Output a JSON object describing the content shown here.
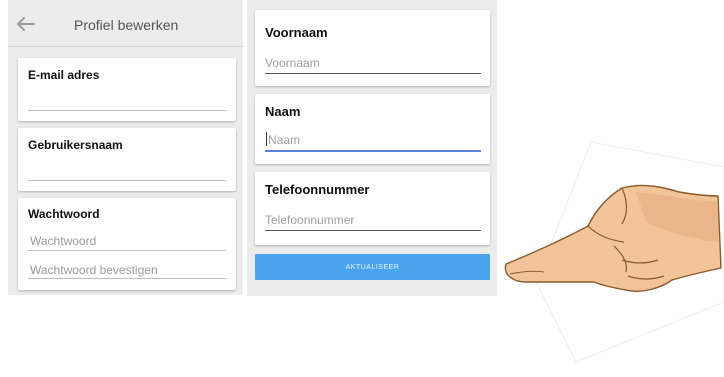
{
  "header": {
    "title": "Profiel bewerken",
    "back_icon": "arrow-left-icon"
  },
  "left_form": {
    "email": {
      "label": "E-mail adres",
      "value": ""
    },
    "username": {
      "label": "Gebruikersnaam",
      "value": ""
    },
    "password": {
      "label": "Wachtwoord",
      "placeholder": "Wachtwoord",
      "confirm_placeholder": "Wachtwoord bevestigen"
    }
  },
  "right_form": {
    "firstname": {
      "label": "Voornaam",
      "placeholder": "Voornaam"
    },
    "lastname": {
      "label": "Naam",
      "placeholder": "Naam"
    },
    "phone": {
      "label": "Telefoonnummer",
      "placeholder": "Telefoonnummer"
    },
    "submit_label": "AKTUALISEER"
  },
  "colors": {
    "accent": "#5b7fe0",
    "button": "#4aa5ee",
    "skin": "#f2c49a"
  },
  "illustration": {
    "icon": "pointing-hand-icon"
  }
}
